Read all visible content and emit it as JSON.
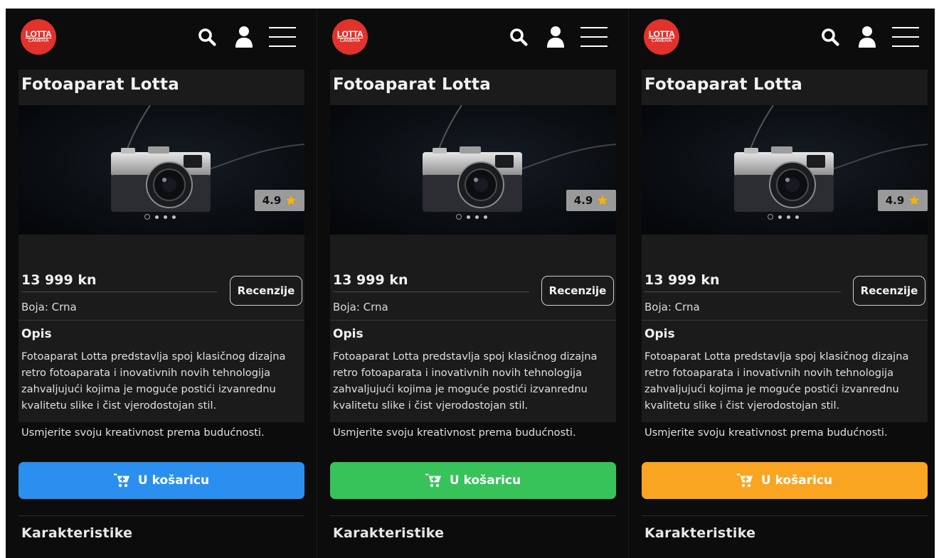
{
  "logo": {
    "line1": "LOTTA",
    "line2": "CAMERA"
  },
  "product": {
    "title": "Fotoaparat Lotta",
    "rating": "4.9",
    "price": "13 999 kn",
    "color": "Boja: Crna",
    "reviews_label": "Recenzije",
    "description_heading": "Opis",
    "description": "Fotoaparat Lotta predstavlja spoj klasičnog dizajna retro fotoaparata i inovativnih novih tehnologija zahvaljujući kojima je moguće postići izvanrednu kvalitetu slike i čist vjerodostojan stil.",
    "tagline": "Usmjerite svoju kreativnost prema budućnosti.",
    "cart_label": "U košaricu",
    "features_heading": "Karakteristike"
  },
  "icons": {
    "search": "search-icon",
    "user": "user-icon",
    "menu": "hamburger-menu-icon",
    "star": "star-icon",
    "cart": "shopping-cart-icon"
  },
  "colors": {
    "background": "#0c0c0c",
    "card": "#1b1b1b",
    "logo_red": "#e1322b",
    "star": "#f5b400",
    "variants": [
      "#2b8ff0",
      "#38c25a",
      "#f9a522"
    ]
  },
  "image_carousel": {
    "slides": 4,
    "active_slide": 1
  }
}
